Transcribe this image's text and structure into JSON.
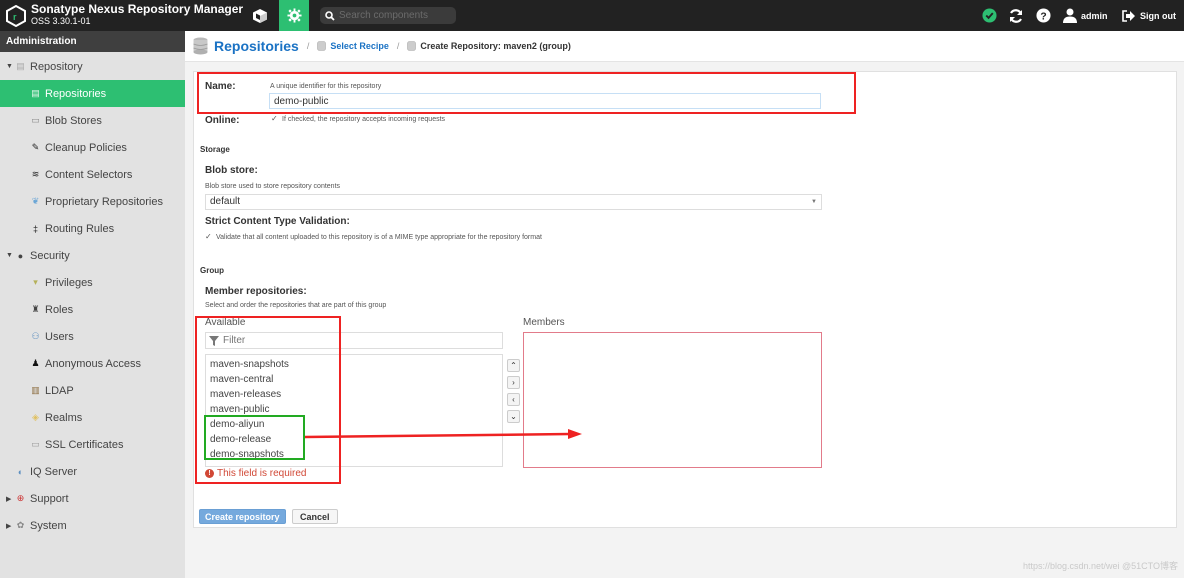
{
  "topbar": {
    "title": "Sonatype Nexus Repository Manager",
    "version": "OSS 3.30.1-01",
    "search_placeholder": "Search components",
    "user_label": "admin",
    "signout_label": "Sign out",
    "admin_active_color": "#2dbf72"
  },
  "sidebar": {
    "header": "Administration",
    "items": [
      {
        "label": "Repository",
        "level": 0,
        "icon": "database-icon",
        "expanded": true
      },
      {
        "label": "Repositories",
        "level": 1,
        "icon": "database-icon",
        "active": true
      },
      {
        "label": "Blob Stores",
        "level": 1,
        "icon": "drive-icon"
      },
      {
        "label": "Cleanup Policies",
        "level": 1,
        "icon": "broom-icon"
      },
      {
        "label": "Content Selectors",
        "level": 1,
        "icon": "layers-icon"
      },
      {
        "label": "Proprietary Repositories",
        "level": 1,
        "icon": "proprietary-icon"
      },
      {
        "label": "Routing Rules",
        "level": 1,
        "icon": "signpost-icon"
      },
      {
        "label": "Security",
        "level": 0,
        "icon": "security-icon",
        "expanded": true
      },
      {
        "label": "Privileges",
        "level": 1,
        "icon": "medal-icon"
      },
      {
        "label": "Roles",
        "level": 1,
        "icon": "role-icon"
      },
      {
        "label": "Users",
        "level": 1,
        "icon": "users-icon"
      },
      {
        "label": "Anonymous Access",
        "level": 1,
        "icon": "user-icon"
      },
      {
        "label": "LDAP",
        "level": 1,
        "icon": "book-icon"
      },
      {
        "label": "Realms",
        "level": 1,
        "icon": "shield-icon"
      },
      {
        "label": "SSL Certificates",
        "level": 1,
        "icon": "certificate-icon"
      },
      {
        "label": "IQ Server",
        "level": 0,
        "icon": "iq-icon"
      },
      {
        "label": "Support",
        "level": 0,
        "icon": "lifebuoy-icon",
        "expanded": false
      },
      {
        "label": "System",
        "level": 0,
        "icon": "gear-icon",
        "expanded": false
      }
    ]
  },
  "breadcrumb": {
    "title": "Repositories",
    "step1": "Select Recipe",
    "step2": "Create Repository: maven2 (group)"
  },
  "form": {
    "name_label": "Name:",
    "name_help": "A unique identifier for this repository",
    "name_value": "demo-public",
    "online_label": "Online:",
    "online_help": "If checked, the repository accepts incoming requests",
    "online_checked": true,
    "storage_section": "Storage",
    "blob_label": "Blob store:",
    "blob_help": "Blob store used to store repository contents",
    "blob_value": "default",
    "strict_label": "Strict Content Type Validation:",
    "strict_help": "Validate that all content uploaded to this repository is of a MIME type appropriate for the repository format",
    "strict_checked": true,
    "group_section": "Group",
    "members_label": "Member repositories:",
    "members_help": "Select and order the repositories that are part of this group",
    "available_label": "Available",
    "filter_placeholder": "Filter",
    "available_items": [
      "maven-snapshots",
      "maven-central",
      "maven-releases",
      "maven-public",
      "demo-aliyun",
      "demo-release",
      "demo-snapshots"
    ],
    "members_title": "Members",
    "members_items": [],
    "error": "This field is required",
    "create_button": "Create repository",
    "cancel_button": "Cancel"
  },
  "watermark": "https://blog.csdn.net/wei @51CTO博客"
}
